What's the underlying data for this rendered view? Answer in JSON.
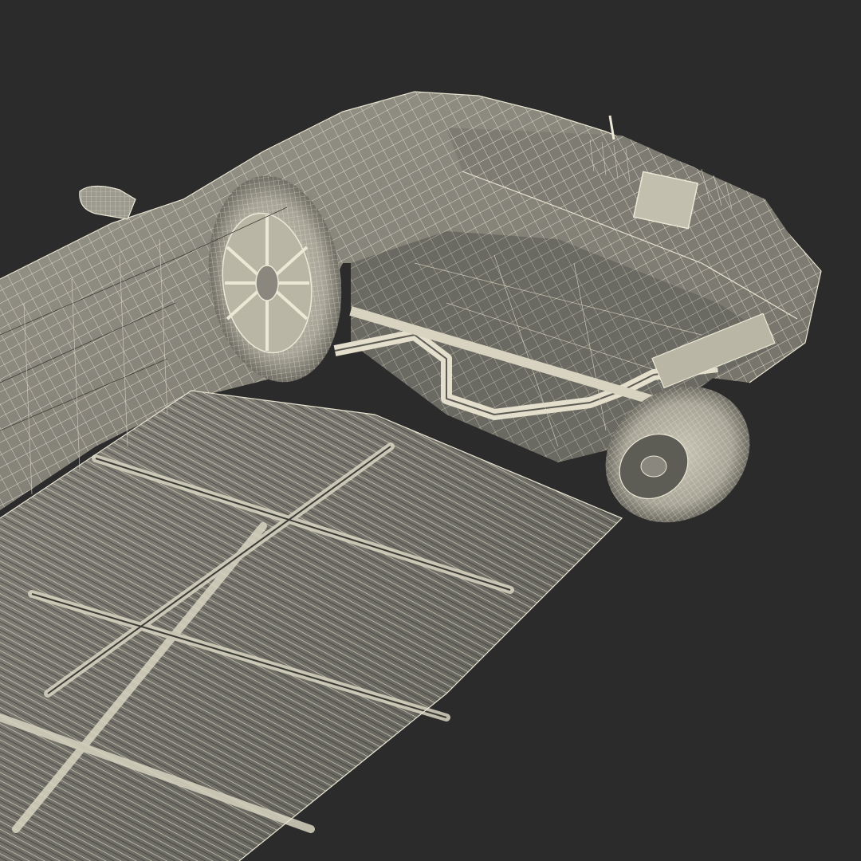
{
  "scene": {
    "subject": "car-underbody-wireframe",
    "colors": {
      "background": "#2b2b2b",
      "wireframe": "#e8e4d2",
      "shade": "#8c8a80",
      "shade_dark": "#55544e"
    },
    "text": []
  }
}
